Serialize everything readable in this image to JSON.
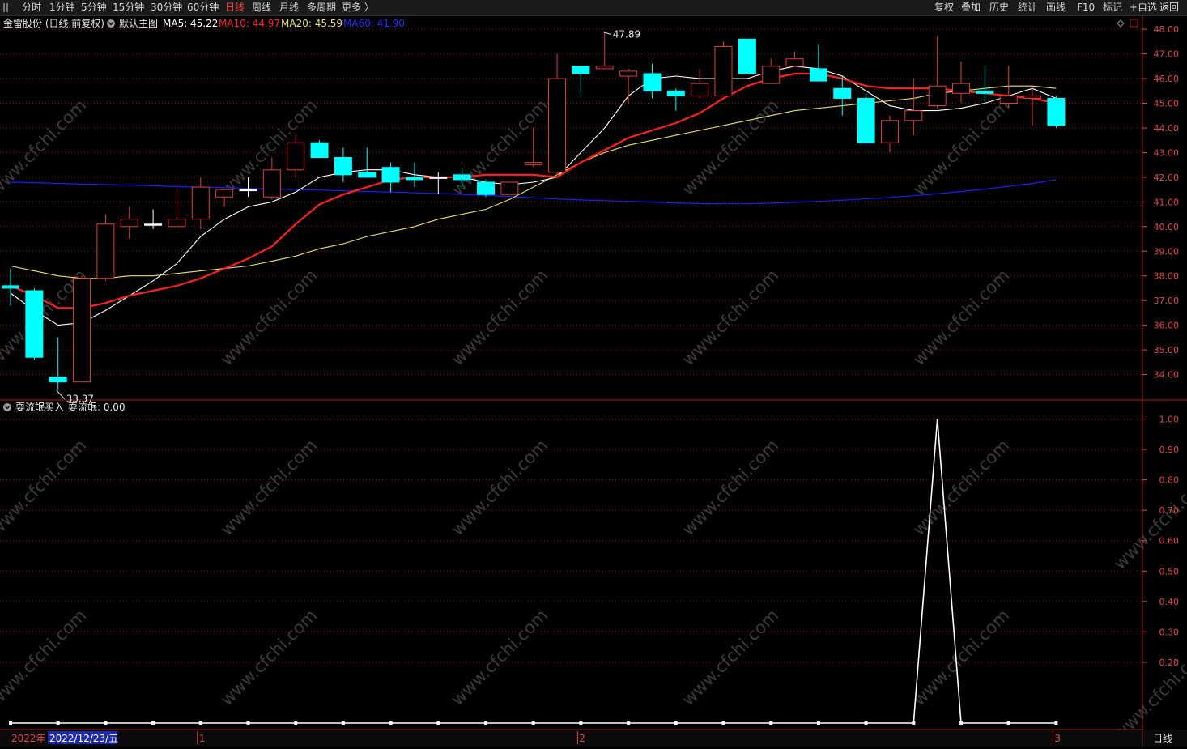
{
  "colors": {
    "up": "#e03c3c",
    "down": "#00ffff",
    "ma5": "#ffffff",
    "ma10": "#ff2020",
    "ma20": "#e8e06a",
    "ma60": "#1c1cff",
    "axis": "#e04848",
    "grid": "#7a1414",
    "frame": "#b01e1e",
    "watermark": "#3a3a3a"
  },
  "toolbar": {
    "left": [
      "分时",
      "1分钟",
      "5分钟",
      "15分钟",
      "30分钟",
      "60分钟",
      "日线",
      "周线",
      "月线",
      "多周期",
      "更多 〉"
    ],
    "active": "日线",
    "right": [
      "复权",
      "叠加",
      "历史",
      "统计",
      "画线",
      "F10",
      "标记",
      "+自选",
      "返回"
    ]
  },
  "main_header": {
    "stock": "金雷股份 (日线,前复权)",
    "template": "默认主图",
    "ma5": "MA5: 45.22",
    "ma10": "MA10: 44.97",
    "ma20": "MA20: 45.59",
    "ma60": "MA60: 41.90"
  },
  "sub_header": {
    "indicator": "耍流氓买入",
    "value": "耍流氓: 0.00"
  },
  "watermark": "www.cfchi.com",
  "bottom_bar": {
    "year": "2022年",
    "date": "2022/12/23/五",
    "month_marks": [
      "1",
      "2",
      "3"
    ],
    "period": "日线"
  },
  "chart_data": [
    {
      "type": "candlestick",
      "yaxis_ticks": [
        "48.00",
        "47.00",
        "46.00",
        "45.00",
        "44.00",
        "43.00",
        "42.00",
        "41.00",
        "40.00",
        "39.00",
        "38.00",
        "37.00",
        "36.00",
        "35.00",
        "34.00"
      ],
      "ylim": [
        33.0,
        48.3
      ],
      "annotations": [
        {
          "text": "47.89",
          "index": 25,
          "value": 47.89
        },
        {
          "text": "33.37",
          "index": 2,
          "value": 33.37
        }
      ],
      "candles": [
        {
          "o": 37.6,
          "h": 38.3,
          "l": 36.8,
          "c": 37.5
        },
        {
          "o": 37.4,
          "h": 37.5,
          "l": 34.6,
          "c": 34.7
        },
        {
          "o": 33.9,
          "h": 35.5,
          "l": 33.37,
          "c": 33.7
        },
        {
          "o": 33.7,
          "h": 38.0,
          "l": 33.7,
          "c": 37.9
        },
        {
          "o": 37.9,
          "h": 40.5,
          "l": 37.8,
          "c": 40.1
        },
        {
          "o": 40.0,
          "h": 40.8,
          "l": 39.5,
          "c": 40.3
        },
        {
          "o": 40.1,
          "h": 40.7,
          "l": 39.9,
          "c": 40.1
        },
        {
          "o": 40.0,
          "h": 41.5,
          "l": 39.9,
          "c": 40.3
        },
        {
          "o": 40.3,
          "h": 42.0,
          "l": 39.9,
          "c": 41.6
        },
        {
          "o": 41.2,
          "h": 41.5,
          "l": 40.8,
          "c": 41.5
        },
        {
          "o": 41.5,
          "h": 42.0,
          "l": 41.2,
          "c": 41.5
        },
        {
          "o": 41.2,
          "h": 42.8,
          "l": 41.1,
          "c": 42.3
        },
        {
          "o": 42.3,
          "h": 43.7,
          "l": 42.0,
          "c": 43.4
        },
        {
          "o": 43.4,
          "h": 43.5,
          "l": 42.8,
          "c": 42.8
        },
        {
          "o": 42.8,
          "h": 43.2,
          "l": 41.8,
          "c": 42.1
        },
        {
          "o": 42.2,
          "h": 43.2,
          "l": 42.0,
          "c": 42.0
        },
        {
          "o": 42.4,
          "h": 42.6,
          "l": 41.4,
          "c": 41.8
        },
        {
          "o": 42.0,
          "h": 42.6,
          "l": 41.6,
          "c": 41.9
        },
        {
          "o": 42.0,
          "h": 42.2,
          "l": 41.3,
          "c": 42.0
        },
        {
          "o": 42.1,
          "h": 42.4,
          "l": 41.6,
          "c": 41.9
        },
        {
          "o": 41.8,
          "h": 41.9,
          "l": 41.2,
          "c": 41.3
        },
        {
          "o": 41.3,
          "h": 41.8,
          "l": 41.3,
          "c": 41.8
        },
        {
          "o": 42.5,
          "h": 44.0,
          "l": 42.4,
          "c": 42.6
        },
        {
          "o": 42.2,
          "h": 47.0,
          "l": 42.1,
          "c": 46.0
        },
        {
          "o": 46.5,
          "h": 46.5,
          "l": 45.3,
          "c": 46.2
        },
        {
          "o": 46.4,
          "h": 47.89,
          "l": 46.4,
          "c": 46.5
        },
        {
          "o": 46.1,
          "h": 46.4,
          "l": 45.0,
          "c": 46.3
        },
        {
          "o": 46.2,
          "h": 46.6,
          "l": 45.2,
          "c": 45.5
        },
        {
          "o": 45.5,
          "h": 45.6,
          "l": 44.7,
          "c": 45.3
        },
        {
          "o": 45.3,
          "h": 46.4,
          "l": 45.2,
          "c": 45.8
        },
        {
          "o": 45.3,
          "h": 47.5,
          "l": 45.3,
          "c": 47.3
        },
        {
          "o": 47.6,
          "h": 47.6,
          "l": 46.2,
          "c": 46.2
        },
        {
          "o": 45.8,
          "h": 46.8,
          "l": 45.8,
          "c": 46.5
        },
        {
          "o": 46.5,
          "h": 47.1,
          "l": 46.5,
          "c": 46.8
        },
        {
          "o": 46.4,
          "h": 47.4,
          "l": 45.9,
          "c": 45.9
        },
        {
          "o": 45.6,
          "h": 46.1,
          "l": 44.5,
          "c": 45.2
        },
        {
          "o": 45.2,
          "h": 45.4,
          "l": 43.4,
          "c": 43.4
        },
        {
          "o": 43.4,
          "h": 44.5,
          "l": 43.0,
          "c": 44.3
        },
        {
          "o": 44.3,
          "h": 46.0,
          "l": 43.7,
          "c": 44.7
        },
        {
          "o": 44.9,
          "h": 47.7,
          "l": 44.8,
          "c": 45.7
        },
        {
          "o": 45.4,
          "h": 46.7,
          "l": 45.0,
          "c": 45.8
        },
        {
          "o": 45.5,
          "h": 46.5,
          "l": 45.0,
          "c": 45.4
        },
        {
          "o": 45.0,
          "h": 46.5,
          "l": 44.8,
          "c": 45.3
        },
        {
          "o": 45.2,
          "h": 45.6,
          "l": 44.1,
          "c": 45.3
        },
        {
          "o": 45.2,
          "h": 45.3,
          "l": 44.0,
          "c": 44.1
        }
      ],
      "ma5": [
        37.3,
        36.6,
        36.0,
        36.1,
        36.6,
        37.2,
        37.8,
        38.5,
        39.6,
        40.3,
        40.8,
        41.0,
        41.4,
        42.0,
        42.2,
        42.3,
        42.3,
        42.1,
        42.0,
        42.0,
        41.8,
        41.7,
        41.8,
        42.0,
        43.0,
        44.0,
        45.3,
        46.0,
        46.1,
        46.0,
        46.0,
        46.0,
        46.3,
        46.5,
        46.4,
        46.1,
        45.5,
        44.9,
        44.7,
        44.7,
        44.8,
        45.0,
        45.3,
        45.6,
        45.2
      ],
      "ma10": [
        37.6,
        37.2,
        36.7,
        36.7,
        36.9,
        37.2,
        37.4,
        37.6,
        37.9,
        38.3,
        38.7,
        39.2,
        40.1,
        40.9,
        41.3,
        41.6,
        41.9,
        42.0,
        42.0,
        42.0,
        42.1,
        42.1,
        42.1,
        42.0,
        42.6,
        43.1,
        43.6,
        43.9,
        44.2,
        44.6,
        45.2,
        45.7,
        46.0,
        46.2,
        46.2,
        46.0,
        45.7,
        45.6,
        45.6,
        45.6,
        45.5,
        45.4,
        45.3,
        45.2,
        45.0
      ],
      "ma20": [
        38.4,
        38.2,
        38.0,
        37.9,
        37.9,
        38.0,
        38.0,
        38.1,
        38.2,
        38.3,
        38.4,
        38.6,
        38.8,
        39.1,
        39.3,
        39.6,
        39.8,
        40.0,
        40.3,
        40.5,
        40.7,
        41.1,
        41.6,
        42.1,
        42.6,
        43.0,
        43.3,
        43.5,
        43.7,
        43.9,
        44.1,
        44.3,
        44.5,
        44.7,
        44.8,
        44.9,
        45.0,
        45.1,
        45.2,
        45.4,
        45.5,
        45.6,
        45.7,
        45.7,
        45.6
      ],
      "ma60": [
        41.8,
        41.78,
        41.75,
        41.72,
        41.7,
        41.68,
        41.65,
        41.62,
        41.6,
        41.58,
        41.55,
        41.52,
        41.5,
        41.48,
        41.45,
        41.42,
        41.4,
        41.37,
        41.34,
        41.3,
        41.27,
        41.22,
        41.17,
        41.12,
        41.08,
        41.05,
        41.02,
        40.99,
        40.96,
        40.93,
        40.92,
        40.92,
        40.95,
        40.98,
        41.02,
        41.07,
        41.12,
        41.18,
        41.25,
        41.33,
        41.42,
        41.52,
        41.63,
        41.75,
        41.9
      ]
    },
    {
      "type": "line",
      "name": "耍流氓",
      "yaxis_ticks": [
        "1.00",
        "0.90",
        "0.80",
        "0.70",
        "0.60",
        "0.50",
        "0.40",
        "0.30",
        "0.20"
      ],
      "ylim": [
        0,
        1.06
      ],
      "values": [
        0,
        0,
        0,
        0,
        0,
        0,
        0,
        0,
        0,
        0,
        0,
        0,
        0,
        0,
        0,
        0,
        0,
        0,
        0,
        0,
        0,
        0,
        0,
        0,
        0,
        0,
        0,
        0,
        0,
        0,
        0,
        0,
        0,
        0,
        0,
        0,
        0,
        0,
        0,
        1,
        0,
        0,
        0,
        0,
        0
      ]
    }
  ]
}
